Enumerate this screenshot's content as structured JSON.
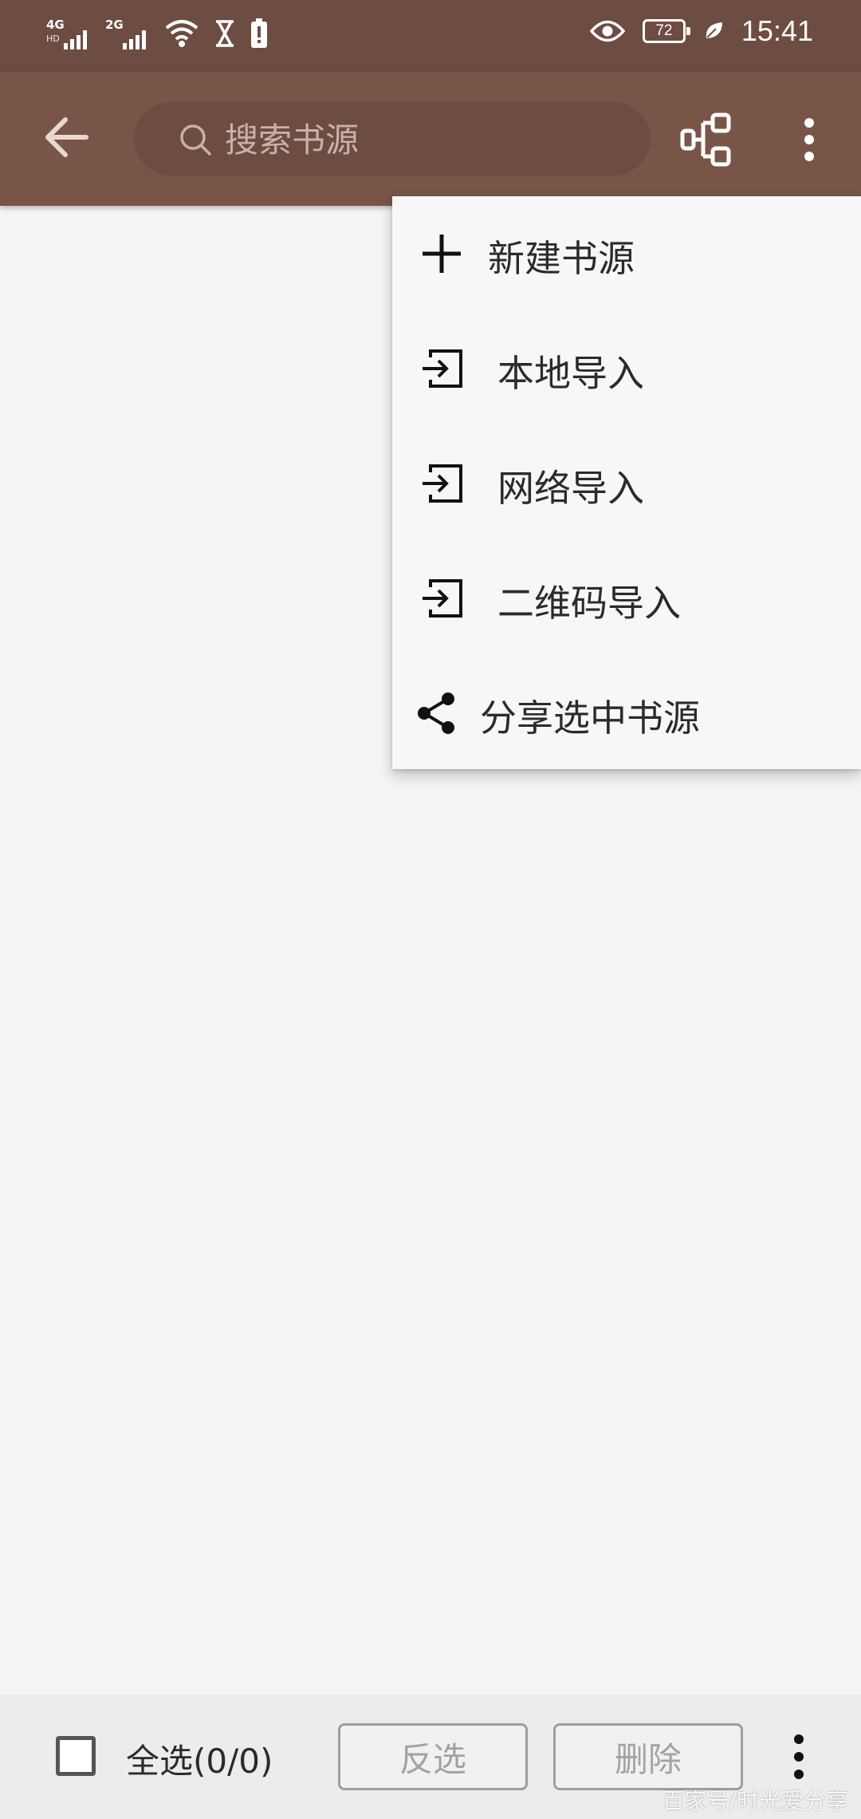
{
  "status_bar": {
    "network1": "4G",
    "network1_sub": "HD",
    "network2": "2G",
    "battery": "72",
    "time": "15:41"
  },
  "toolbar": {
    "search_placeholder": "搜索书源",
    "colors": {
      "status": "#6d4c41",
      "toolbar": "#795548",
      "search": "#6d4c41"
    }
  },
  "menu": {
    "items": [
      {
        "label": "新建书源",
        "icon": "plus-icon"
      },
      {
        "label": "本地导入",
        "icon": "import-icon"
      },
      {
        "label": "网络导入",
        "icon": "import-icon"
      },
      {
        "label": "二维码导入",
        "icon": "import-icon"
      },
      {
        "label": "分享选中书源",
        "icon": "share-icon"
      }
    ]
  },
  "bottom_bar": {
    "select_all_label": "全选(0/0)",
    "invert_label": "反选",
    "delete_label": "删除"
  },
  "watermark": "百家号/时光爱分享"
}
